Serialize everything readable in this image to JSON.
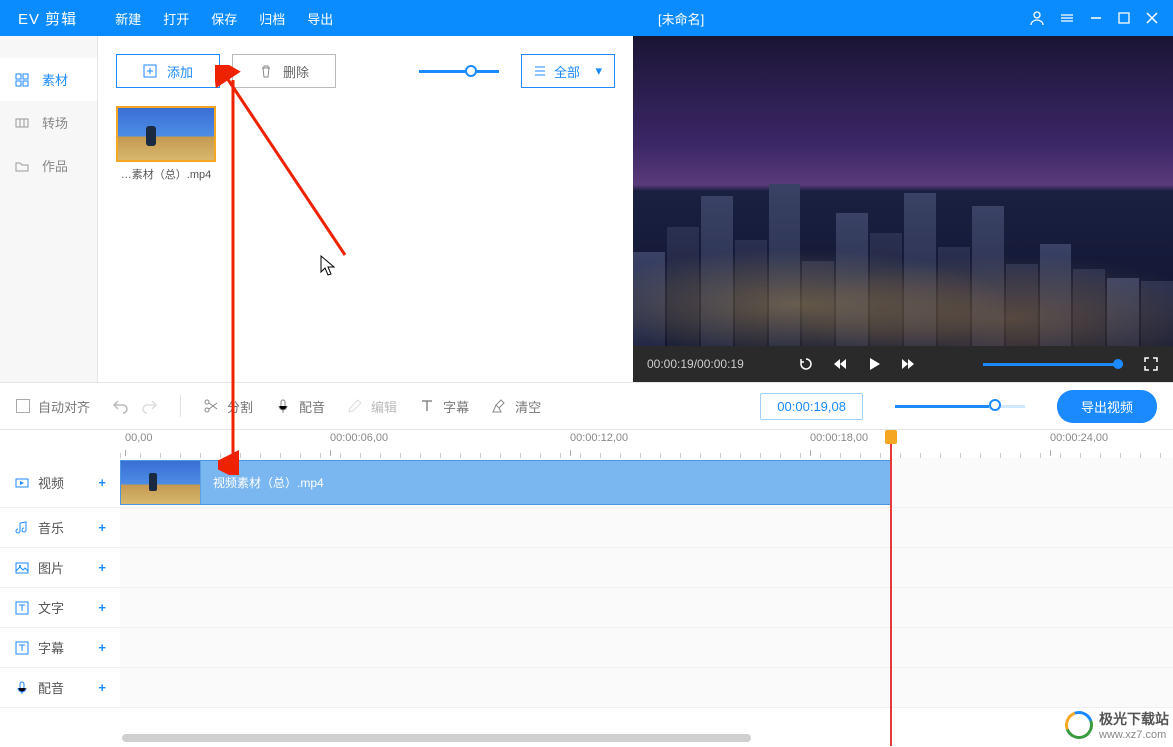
{
  "app_title": "EV 剪辑",
  "menu": {
    "new": "新建",
    "open": "打开",
    "save": "保存",
    "archive": "归档",
    "export": "导出"
  },
  "doc_title": "[未命名]",
  "sidebar": {
    "material": "素材",
    "transition": "转场",
    "works": "作品"
  },
  "toolbar": {
    "add": "添加",
    "delete": "删除",
    "filter": "全部"
  },
  "media": {
    "item0": {
      "name": "…素材（总）.mp4"
    }
  },
  "preview": {
    "time": "00:00:19/00:00:19"
  },
  "timeline_toolbar": {
    "auto_align": "自动对齐",
    "split": "分割",
    "dub": "配音",
    "edit": "编辑",
    "subtitle": "字幕",
    "clear": "清空",
    "timecode": "00:00:19,08",
    "export": "导出视频"
  },
  "ruler": {
    "t0": "00,00",
    "t1": "00:00:06,00",
    "t2": "00:00:12,00",
    "t3": "00:00:18,00",
    "t4": "00:00:24,00"
  },
  "tracks": {
    "video": "视频",
    "music": "音乐",
    "image": "图片",
    "text": "文字",
    "subtitle": "字幕",
    "dub": "配音"
  },
  "clip": {
    "name": "视频素材（总）.mp4"
  },
  "watermark": {
    "cn": "极光下载站",
    "url": "www.xz7.com"
  }
}
